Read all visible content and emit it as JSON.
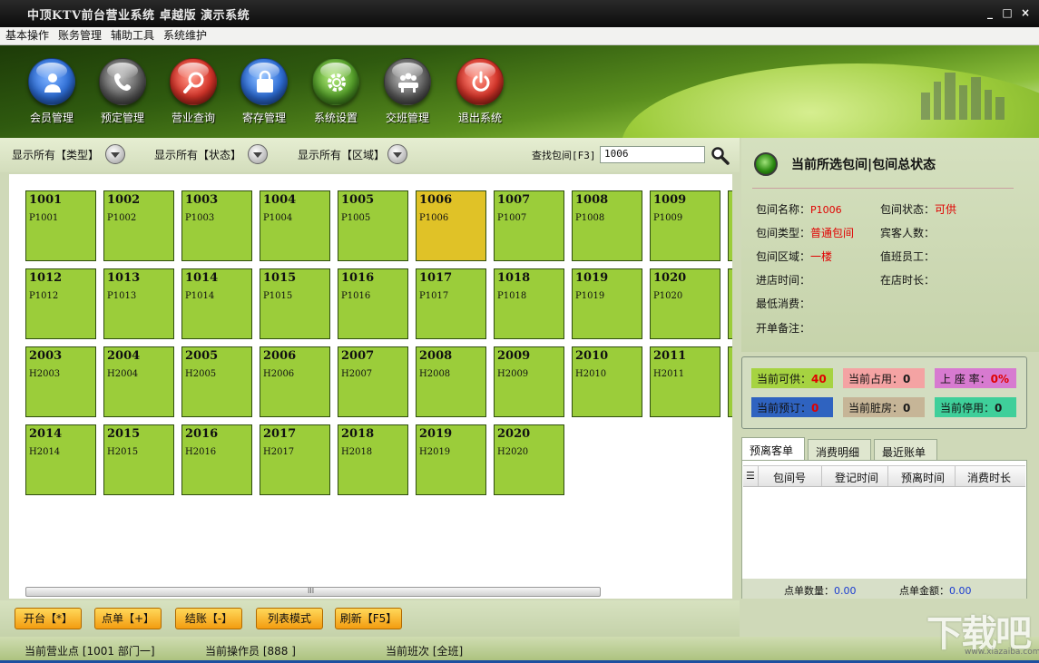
{
  "window": {
    "title": "中顶KTV前台营业系统 卓越版 演示系统",
    "controls": [
      "_",
      "□",
      "×"
    ]
  },
  "menu": [
    "基本操作",
    "账务管理",
    "辅助工具",
    "系统维护"
  ],
  "toolbar": [
    {
      "label": "会员管理",
      "icon": "person-icon",
      "color": "#2f6fd8"
    },
    {
      "label": "预定管理",
      "icon": "phone-icon",
      "color": "#6a6a6a"
    },
    {
      "label": "营业查询",
      "icon": "search-icon",
      "color": "#d8352a"
    },
    {
      "label": "寄存管理",
      "icon": "bag-icon",
      "color": "#2f6fd8"
    },
    {
      "label": "系统设置",
      "icon": "gear-icon",
      "color": "#55a02a"
    },
    {
      "label": "交班管理",
      "icon": "group-icon",
      "color": "#6a6a6a"
    },
    {
      "label": "退出系统",
      "icon": "power-icon",
      "color": "#d8352a"
    }
  ],
  "filters": {
    "type": "显示所有【类型】",
    "status": "显示所有【状态】",
    "area": "显示所有【区域】",
    "search_label": "查找包间[F3]",
    "search_value": "1006"
  },
  "rooms": [
    {
      "no": "1001",
      "code": "P1001"
    },
    {
      "no": "1002",
      "code": "P1002"
    },
    {
      "no": "1003",
      "code": "P1003"
    },
    {
      "no": "1004",
      "code": "P1004"
    },
    {
      "no": "1005",
      "code": "P1005"
    },
    {
      "no": "1006",
      "code": "P1006",
      "selected": true
    },
    {
      "no": "1007",
      "code": "P1007"
    },
    {
      "no": "1008",
      "code": "P1008"
    },
    {
      "no": "1009",
      "code": "P1009"
    },
    {
      "no": "1012",
      "code": "P1012"
    },
    {
      "no": "1013",
      "code": "P1013"
    },
    {
      "no": "1014",
      "code": "P1014"
    },
    {
      "no": "1015",
      "code": "P1015"
    },
    {
      "no": "1016",
      "code": "P1016"
    },
    {
      "no": "1017",
      "code": "P1017"
    },
    {
      "no": "1018",
      "code": "P1018"
    },
    {
      "no": "1019",
      "code": "P1019"
    },
    {
      "no": "1020",
      "code": "P1020"
    },
    {
      "no": "2003",
      "code": "H2003"
    },
    {
      "no": "2004",
      "code": "H2004"
    },
    {
      "no": "2005",
      "code": "H2005"
    },
    {
      "no": "2006",
      "code": "H2006"
    },
    {
      "no": "2007",
      "code": "H2007"
    },
    {
      "no": "2008",
      "code": "H2008"
    },
    {
      "no": "2009",
      "code": "H2009"
    },
    {
      "no": "2010",
      "code": "H2010"
    },
    {
      "no": "2011",
      "code": "H2011"
    },
    {
      "no": "2014",
      "code": "H2014"
    },
    {
      "no": "2015",
      "code": "H2015"
    },
    {
      "no": "2016",
      "code": "H2016"
    },
    {
      "no": "2017",
      "code": "H2017"
    },
    {
      "no": "2018",
      "code": "H2018"
    },
    {
      "no": "2019",
      "code": "H2019"
    },
    {
      "no": "2020",
      "code": "H2020"
    }
  ],
  "room_colors": {
    "available": "#9bcd3a",
    "selected": "#e0c227"
  },
  "detail": {
    "title": "当前所选包间|包间总状态",
    "name_label": "包间名称：",
    "name_value": "P1006",
    "status_label": "包间状态：",
    "status_value": "可供",
    "type_label": "包间类型：",
    "type_value": "普通包间",
    "guests_label": "宾客人数：",
    "area_label": "包间区域：",
    "area_value": "一楼",
    "staff_label": "值班员工：",
    "checkin_label": "进店时间：",
    "duration_label": "在店时长：",
    "min_label": "最低消费：",
    "note_label": "开单备注："
  },
  "stats": [
    {
      "label": "当前可供：",
      "value": "40",
      "bg": "#a6d341",
      "vcolor": "#e00000"
    },
    {
      "label": "当前占用：",
      "value": "0",
      "bg": "#f4a3a3",
      "vcolor": "#1a1a1a"
    },
    {
      "label": "上 座 率：",
      "value": "0%",
      "bg": "#d77ad0",
      "vcolor": "#e00000"
    },
    {
      "label": "当前预订：",
      "value": "0",
      "bg": "#2f63c0",
      "vcolor": "#e00000"
    },
    {
      "label": "当前脏房：",
      "value": "0",
      "bg": "#c6b597",
      "vcolor": "#1a1a1a"
    },
    {
      "label": "当前停用：",
      "value": "0",
      "bg": "#3fcf9a",
      "vcolor": "#1a1a1a"
    }
  ],
  "tabs": [
    "预离客单",
    "消费明细",
    "最近账单"
  ],
  "table": {
    "columns": [
      "包间号",
      "登记时间",
      "预离时间",
      "消费时长"
    ],
    "footer_count_label": "点单数量：",
    "footer_count": "0.00",
    "footer_amount_label": "点单金额：",
    "footer_amount": "0.00"
  },
  "buttons": [
    "开台【*】",
    "点单【+】",
    "结账【-】",
    "列表模式",
    "刷新【F5】"
  ],
  "status": {
    "point": "当前营业点 [1001 部门一]",
    "operator": "当前操作员 [888 ]",
    "shift": "当前班次 [全班]"
  },
  "watermark": {
    "text": "下载吧",
    "url": "www.xiazaiba.com"
  }
}
